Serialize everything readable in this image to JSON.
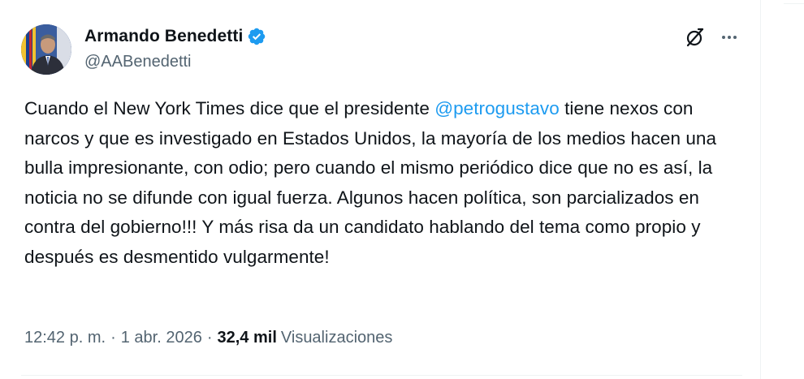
{
  "author": {
    "name": "Armando Benedetti",
    "handle": "@AABenedetti",
    "verified_color": "#1d9bf0",
    "avatar_icon": "profile-photo"
  },
  "header_actions": {
    "grok_icon": "grok-icon",
    "more_icon": "more-horizontal-icon"
  },
  "tweet": {
    "text_before": "Cuando el New York Times dice que el presidente ",
    "mention": "@petrogustavo",
    "text_after": " tiene nexos con narcos y que es investigado en Estados Unidos, la mayoría de los medios hacen una bulla impresionante, con odio; pero cuando el mismo periódico dice que no es así, la noticia no se difunde con igual fuerza. Algunos hacen política, son parcializados en contra del gobierno!!! Y más risa da un candidato hablando del tema como propio y después es desmentido vulgarmente!"
  },
  "meta": {
    "time": "12:42 p. m.",
    "separator": "·",
    "date": "1 abr. 2026",
    "views_count": "32,4 mil",
    "views_label": "Visualizaciones"
  },
  "colors": {
    "text": "#0f1419",
    "secondary": "#536471",
    "link": "#1d9bf0",
    "divider": "#eff3f4"
  }
}
